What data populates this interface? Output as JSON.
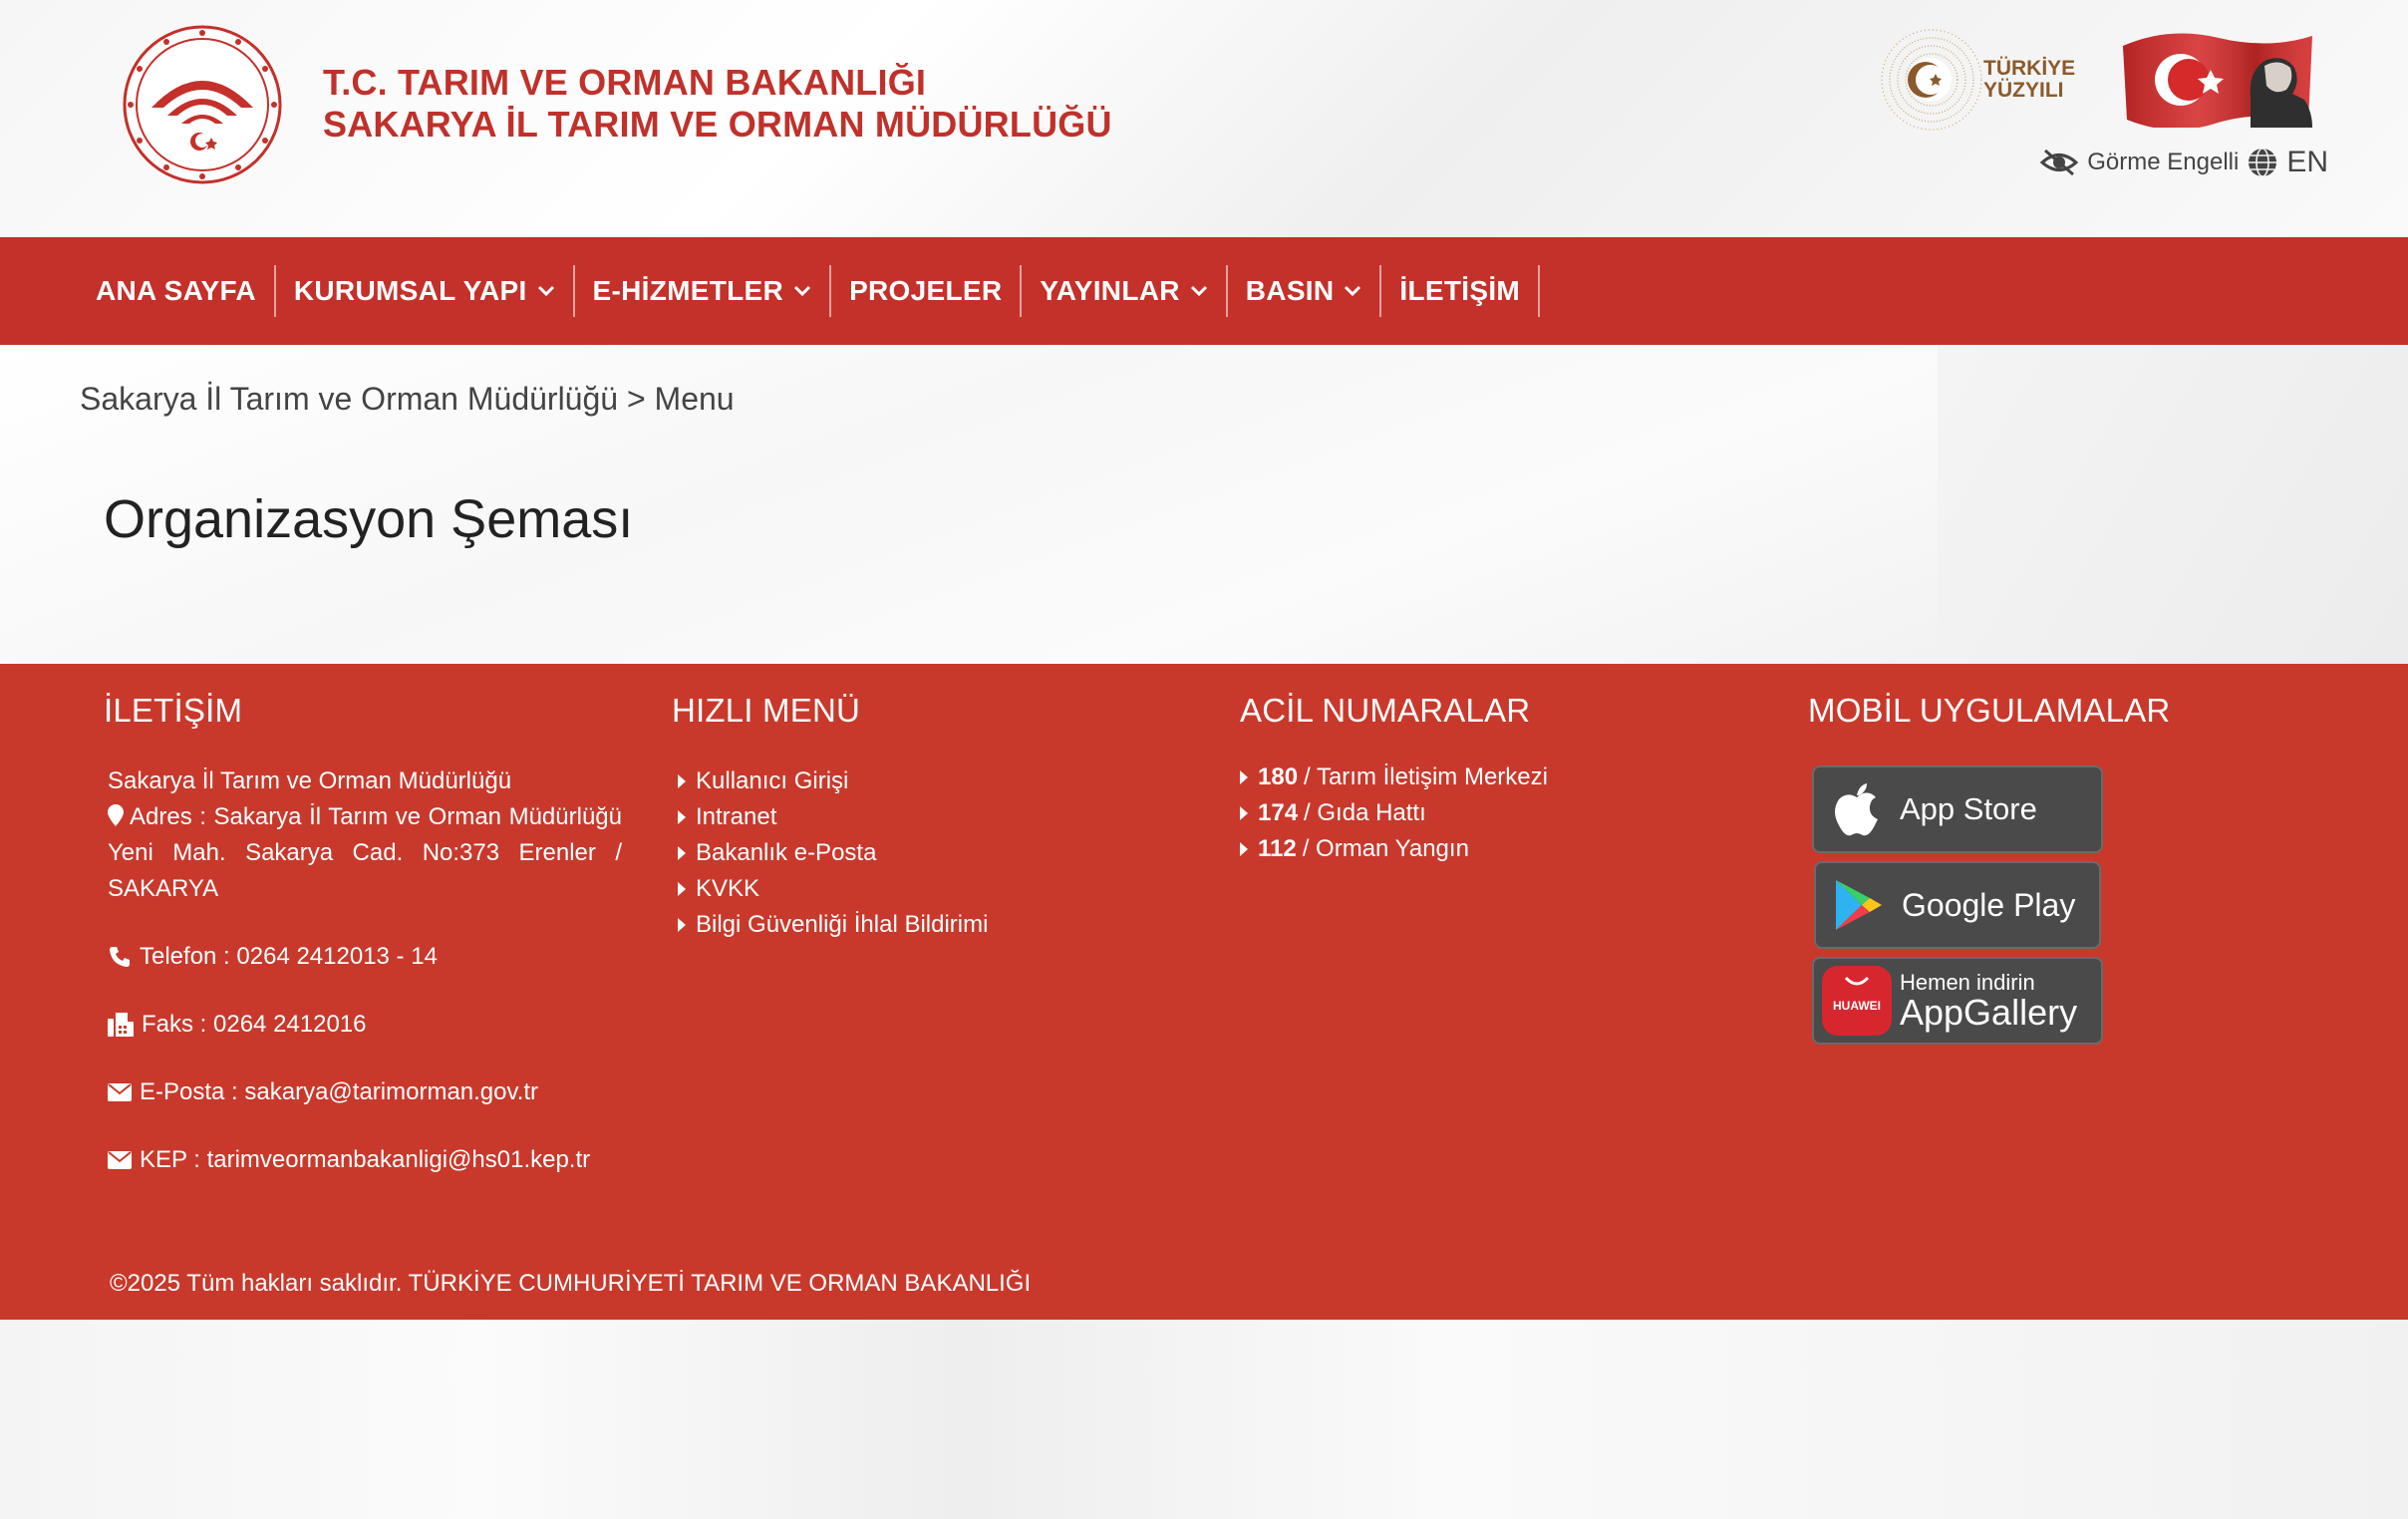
{
  "header": {
    "ministry_line1": "T.C. TARIM VE ORMAN BAKANLIĞI",
    "ministry_line2": "SAKARYA İL TARIM VE ORMAN MÜDÜRLÜĞÜ",
    "turkiye_line1": "TÜRKİYE",
    "turkiye_line2": "YÜZYILI",
    "accessibility_label": "Görme Engelli",
    "language_label": "EN"
  },
  "nav": {
    "items": [
      {
        "label": "ANA SAYFA"
      },
      {
        "label": "KURUMSAL YAPI"
      },
      {
        "label": "E-HİZMETLER"
      },
      {
        "label": "PROJELER"
      },
      {
        "label": "YAYINLAR"
      },
      {
        "label": "BASIN"
      },
      {
        "label": "İLETİŞİM"
      }
    ]
  },
  "breadcrumb": {
    "home": "Sakarya İl Tarım ve Orman Müdürlüğü",
    "separator": ">",
    "current": "Menu"
  },
  "page": {
    "title": "Organizasyon Şeması"
  },
  "footer": {
    "contact": {
      "heading": "İLETİŞİM",
      "org": "Sakarya İl Tarım ve Orman Müdürlüğü",
      "address": "Adres : Sakarya İl Tarım ve Orman Müdürlüğü Yeni Mah. Sakarya Cad. No:373 Erenler / SAKARYA",
      "phone": "Telefon : 0264 2412013 - 14",
      "fax": "Faks : 0264 2412016",
      "email": "E-Posta : sakarya@tarimorman.gov.tr",
      "kep": "KEP : tarimveormanbakanligi@hs01.kep.tr"
    },
    "quick_menu": {
      "heading": "HIZLI MENÜ",
      "items": [
        {
          "label": "Kullanıcı Girişi"
        },
        {
          "label": "Intranet"
        },
        {
          "label": "Bakanlık e-Posta"
        },
        {
          "label": "KVKK"
        },
        {
          "label": "Bilgi Güvenliği İhlal Bildirimi"
        }
      ]
    },
    "emergency": {
      "heading": "ACİL NUMARALAR",
      "items": [
        {
          "number": "180",
          "label": " / Tarım İletişim Merkezi"
        },
        {
          "number": "174",
          "label": " / Gıda Hattı"
        },
        {
          "number": "112",
          "label": " / Orman Yangın"
        }
      ]
    },
    "mobile": {
      "heading": "MOBİL UYGULAMALAR",
      "app_store": "App Store",
      "google_play": "Google Play",
      "huawei_small": "Hemen indirin",
      "huawei_big": "AppGallery",
      "huawei_brand": "HUAWEI"
    },
    "copyright": "©2025 Tüm hakları saklıdır. TÜRKİYE CUMHURİYETİ TARIM VE ORMAN BAKANLIĞI"
  },
  "colors": {
    "brand_red": "#c4302a",
    "footer_red": "#c8392c",
    "title_red": "#c0312b"
  }
}
